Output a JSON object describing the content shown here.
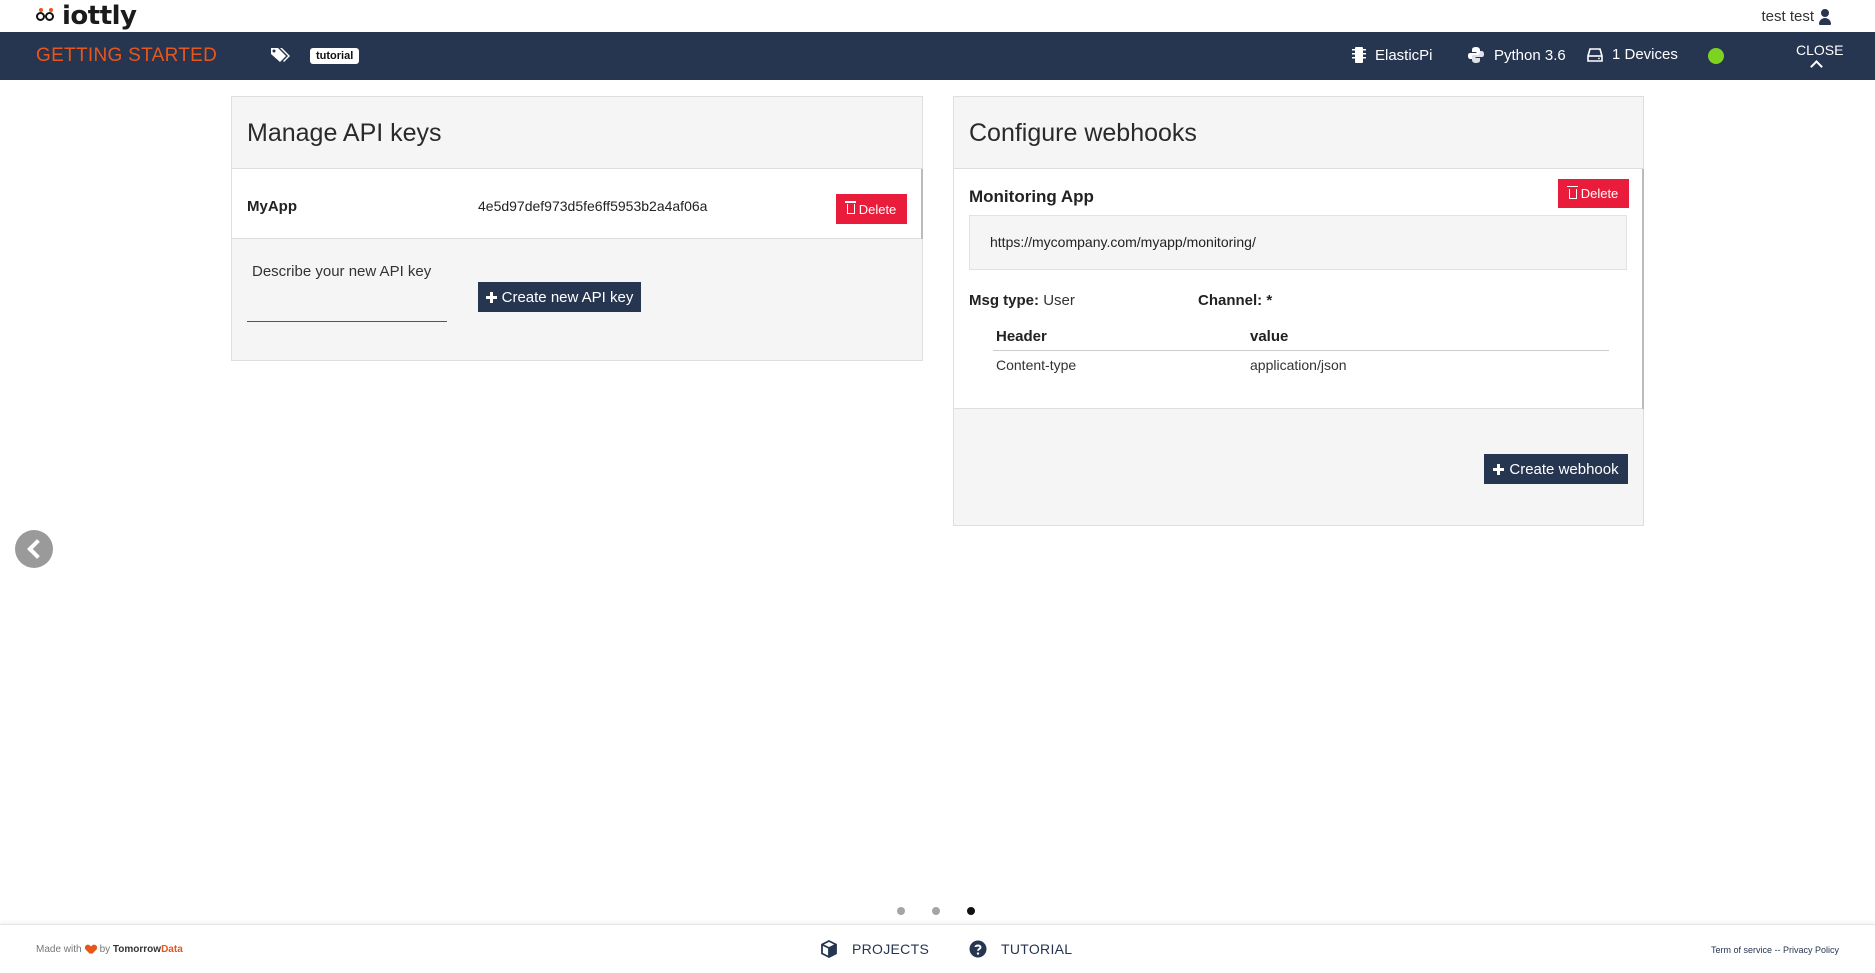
{
  "app": {
    "logo_text": "iottly",
    "user_name": "test test"
  },
  "navbar": {
    "title": "GETTING STARTED",
    "tag_label": "tutorial",
    "board": "ElasticPi",
    "python": "Python 3.6",
    "devices": "1 Devices",
    "status_color": "#7ed321",
    "close_label": "CLOSE"
  },
  "api_keys": {
    "title": "Manage API keys",
    "items": [
      {
        "name": "MyApp",
        "key": "4e5d97def973d5fe6ff5953b2a4af06a",
        "delete_label": "Delete"
      }
    ],
    "describe_label": "Describe your new API key",
    "describe_value": "",
    "create_label": "Create new API key"
  },
  "webhooks": {
    "title": "Configure webhooks",
    "items": [
      {
        "name": "Monitoring App",
        "delete_label": "Delete",
        "url": "https://mycompany.com/myapp/monitoring/",
        "msg_type_label": "Msg type:",
        "msg_type_value": "User",
        "channel_label": "Channel:",
        "channel_value": "*",
        "headers_columns": [
          "Header",
          "value"
        ],
        "headers": [
          {
            "header": "Content-type",
            "value": "application/json"
          }
        ]
      }
    ],
    "create_label": "Create webhook"
  },
  "pager": {
    "total": 3,
    "active": 3
  },
  "footer": {
    "made_with": "Made with",
    "by": "by",
    "brand_a": "Tomorrow",
    "brand_b": "Data",
    "projects": "PROJECTS",
    "tutorial": "TUTORIAL",
    "terms": "Term of service",
    "sep": "--",
    "privacy": "Privacy Policy"
  },
  "colors": {
    "navy": "#263550",
    "accent": "#e8561c",
    "danger": "#ea1c3c"
  }
}
